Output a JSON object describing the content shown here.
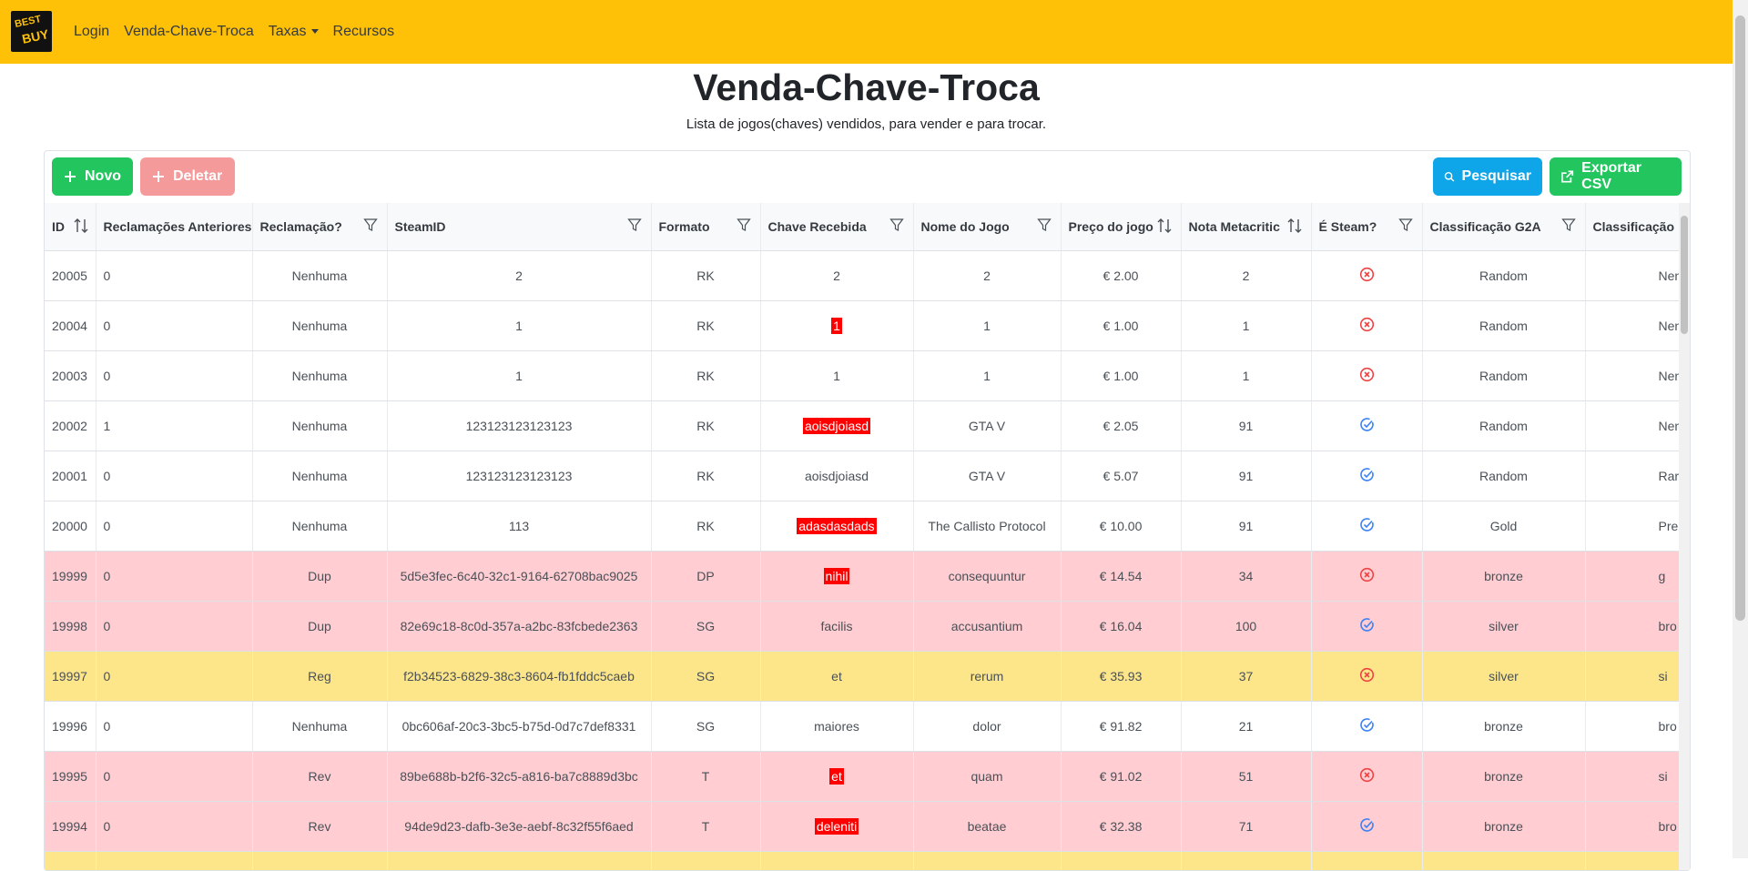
{
  "logo": {
    "line1": "BEST",
    "line2": "BUY"
  },
  "nav": {
    "login": "Login",
    "venda": "Venda-Chave-Troca",
    "taxas": "Taxas",
    "recursos": "Recursos"
  },
  "page": {
    "title": "Venda-Chave-Troca",
    "subtitle": "Lista de jogos(chaves) vendidos, para vender e para trocar."
  },
  "toolbar": {
    "novo": "Novo",
    "deletar": "Deletar",
    "pesquisar": "Pesquisar",
    "exportar": "Exportar CSV"
  },
  "table": {
    "columns": [
      {
        "label": "ID",
        "icon": "sort-icon"
      },
      {
        "label": "Reclamações Anteriores",
        "icon": ""
      },
      {
        "label": "Reclamação?",
        "icon": "filter-icon"
      },
      {
        "label": "SteamID",
        "icon": "filter-icon"
      },
      {
        "label": "Formato",
        "icon": "filter-icon"
      },
      {
        "label": "Chave Recebida",
        "icon": "filter-icon"
      },
      {
        "label": "Nome do Jogo",
        "icon": "filter-icon"
      },
      {
        "label": "Preço do jogo",
        "icon": "sort-icon"
      },
      {
        "label": "Nota Metacritic",
        "icon": "sort-icon"
      },
      {
        "label": "É Steam?",
        "icon": "filter-icon"
      },
      {
        "label": "Classificação G2A",
        "icon": "filter-icon"
      },
      {
        "label": "Classificação",
        "icon": ""
      }
    ],
    "rows": [
      {
        "id": "20005",
        "prev": "0",
        "recl": "Nenhuma",
        "steamid": "2",
        "formato": "RK",
        "chave": "2",
        "chave_hl": false,
        "nome": "2",
        "preco": "€ 2.00",
        "nota": "2",
        "steam": false,
        "g2a": "Random",
        "class": "Nen",
        "color": "white"
      },
      {
        "id": "20004",
        "prev": "0",
        "recl": "Nenhuma",
        "steamid": "1",
        "formato": "RK",
        "chave": "1",
        "chave_hl": true,
        "nome": "1",
        "preco": "€ 1.00",
        "nota": "1",
        "steam": false,
        "g2a": "Random",
        "class": "Nen",
        "color": "white"
      },
      {
        "id": "20003",
        "prev": "0",
        "recl": "Nenhuma",
        "steamid": "1",
        "formato": "RK",
        "chave": "1",
        "chave_hl": false,
        "nome": "1",
        "preco": "€ 1.00",
        "nota": "1",
        "steam": false,
        "g2a": "Random",
        "class": "Nen",
        "color": "white"
      },
      {
        "id": "20002",
        "prev": "1",
        "recl": "Nenhuma",
        "steamid": "123123123123123",
        "formato": "RK",
        "chave": "aoisdjoiasd",
        "chave_hl": true,
        "nome": "GTA V",
        "preco": "€ 2.05",
        "nota": "91",
        "steam": true,
        "g2a": "Random",
        "class": "Nen",
        "color": "white"
      },
      {
        "id": "20001",
        "prev": "0",
        "recl": "Nenhuma",
        "steamid": "123123123123123",
        "formato": "RK",
        "chave": "aoisdjoiasd",
        "chave_hl": false,
        "nome": "GTA V",
        "preco": "€ 5.07",
        "nota": "91",
        "steam": true,
        "g2a": "Random",
        "class": "Rar",
        "color": "white"
      },
      {
        "id": "20000",
        "prev": "0",
        "recl": "Nenhuma",
        "steamid": "113",
        "formato": "RK",
        "chave": "adasdasdads",
        "chave_hl": true,
        "nome": "The Callisto Protocol",
        "preco": "€ 10.00",
        "nota": "91",
        "steam": true,
        "g2a": "Gold",
        "class": "Pre",
        "color": "white"
      },
      {
        "id": "19999",
        "prev": "0",
        "recl": "Dup",
        "steamid": "5d5e3fec-6c40-32c1-9164-62708bac9025",
        "formato": "DP",
        "chave": "nihil",
        "chave_hl": true,
        "nome": "consequuntur",
        "preco": "€ 14.54",
        "nota": "34",
        "steam": false,
        "g2a": "bronze",
        "class": "g",
        "color": "pink"
      },
      {
        "id": "19998",
        "prev": "0",
        "recl": "Dup",
        "steamid": "82e69c18-8c0d-357a-a2bc-83fcbede2363",
        "formato": "SG",
        "chave": "facilis",
        "chave_hl": false,
        "nome": "accusantium",
        "preco": "€ 16.04",
        "nota": "100",
        "steam": true,
        "g2a": "silver",
        "class": "bro",
        "color": "pink"
      },
      {
        "id": "19997",
        "prev": "0",
        "recl": "Reg",
        "steamid": "f2b34523-6829-38c3-8604-fb1fddc5caeb",
        "formato": "SG",
        "chave": "et",
        "chave_hl": false,
        "nome": "rerum",
        "preco": "€ 35.93",
        "nota": "37",
        "steam": false,
        "g2a": "silver",
        "class": "si",
        "color": "yellow"
      },
      {
        "id": "19996",
        "prev": "0",
        "recl": "Nenhuma",
        "steamid": "0bc606af-20c3-3bc5-b75d-0d7c7def8331",
        "formato": "SG",
        "chave": "maiores",
        "chave_hl": false,
        "nome": "dolor",
        "preco": "€ 91.82",
        "nota": "21",
        "steam": true,
        "g2a": "bronze",
        "class": "bro",
        "color": "white"
      },
      {
        "id": "19995",
        "prev": "0",
        "recl": "Rev",
        "steamid": "89be688b-b2f6-32c5-a816-ba7c8889d3bc",
        "formato": "T",
        "chave": "et",
        "chave_hl": true,
        "nome": "quam",
        "preco": "€ 91.02",
        "nota": "51",
        "steam": false,
        "g2a": "bronze",
        "class": "si",
        "color": "pink"
      },
      {
        "id": "19994",
        "prev": "0",
        "recl": "Rev",
        "steamid": "94de9d23-dafb-3e3e-aebf-8c32f55f6aed",
        "formato": "T",
        "chave": "deleniti",
        "chave_hl": true,
        "nome": "beatae",
        "preco": "€ 32.38",
        "nota": "71",
        "steam": true,
        "g2a": "bronze",
        "class": "bro",
        "color": "pink"
      },
      {
        "id": "",
        "prev": "",
        "recl": "",
        "steamid": "",
        "formato": "",
        "chave": "",
        "chave_hl": false,
        "nome": "",
        "preco": "",
        "nota": "",
        "steam": null,
        "g2a": "",
        "class": "",
        "color": "yellow"
      }
    ]
  },
  "colors": {
    "navbar": "#ffc107",
    "novo": "#22c55e",
    "deletar": "#f59a9a",
    "pesquisar": "#0ea5e9",
    "row_pink": "#ffcdd2",
    "row_yellow": "#fde68a",
    "highlight": "#ff0000"
  }
}
